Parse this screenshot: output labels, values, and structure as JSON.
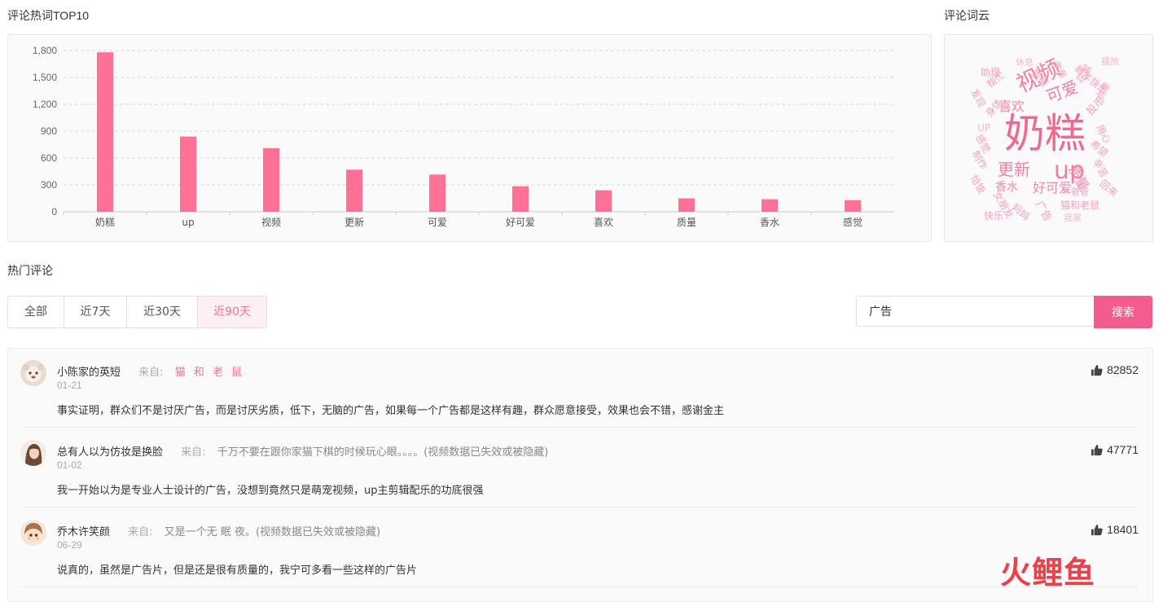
{
  "chart_section": {
    "title": "评论热词TOP10"
  },
  "wordcloud_section": {
    "title": "评论词云"
  },
  "chart_data": {
    "type": "bar",
    "categories": [
      "奶糕",
      "up",
      "视频",
      "更新",
      "可爱",
      "好可爱",
      "喜欢",
      "质量",
      "香水",
      "感觉"
    ],
    "values": [
      1780,
      840,
      710,
      470,
      415,
      285,
      240,
      150,
      140,
      130
    ],
    "ylim": [
      0,
      1800
    ],
    "yticks": [
      0,
      300,
      600,
      900,
      1200,
      1500,
      1800
    ],
    "ytick_labels": [
      "0",
      "300",
      "600",
      "900",
      "1,200",
      "1,500",
      "1,800"
    ],
    "grid": true,
    "bar_color": "#ff7096",
    "title": "",
    "xlabel": "",
    "ylabel": ""
  },
  "wordcloud": {
    "words": [
      "奶糕",
      "视频",
      "up",
      "更新",
      "可爱",
      "好可爱",
      "喜欢",
      "质量",
      "香水",
      "猫和老鼠",
      "助理",
      "休息",
      "猫猫",
      "谢谢",
      "新年快乐",
      "播放",
      "花絮",
      "创意",
      "投币",
      "用心",
      "希望",
      "辛苦",
      "回来",
      "爸爸",
      "广告",
      "妈妈",
      "我家",
      "快乐",
      "恰饭",
      "女朋友",
      "制作",
      "感觉",
      "身体",
      "UP",
      "发现",
      "帮忙"
    ]
  },
  "hot_comments": {
    "title": "热门评论"
  },
  "tabs": [
    {
      "label": "全部",
      "active": false
    },
    {
      "label": "近7天",
      "active": false
    },
    {
      "label": "近30天",
      "active": false
    },
    {
      "label": "近90天",
      "active": true
    }
  ],
  "search": {
    "value": "广告",
    "button": "搜索"
  },
  "comments": [
    {
      "user": "小陈家的英短",
      "from_label": "来自:",
      "from": "猫 和 老 鼠",
      "from_style": "pink",
      "date": "01-21",
      "text": "事实证明，群众们不是讨厌广告，而是讨厌劣质，低下，无脑的广告，如果每一个广告都是这样有趣，群众愿意接受，效果也会不错，感谢金主",
      "likes": "82852"
    },
    {
      "user": "总有人以为仿妆是换脸",
      "from_label": "来自:",
      "from": "千万不要在跟你家猫下棋的时候玩心眼。。。。(视频数据已失效或被隐藏)",
      "from_style": "gray",
      "date": "01-02",
      "text": "我一开始以为是专业人士设计的广告，没想到竟然只是萌宠视频，up主剪辑配乐的功底很强",
      "likes": "47771"
    },
    {
      "user": "乔木许笑颜",
      "from_label": "来自:",
      "from": "又是一个无 眠 夜。(视频数据已失效或被隐藏)",
      "from_style": "gray",
      "date": "06-29",
      "text": "说真的，虽然是广告片，但是还是很有质量的，我宁可多看一些这样的广告片",
      "likes": "18401"
    }
  ],
  "logo": {
    "c1": "火",
    "c2": "鲤",
    "c3": "鱼"
  }
}
